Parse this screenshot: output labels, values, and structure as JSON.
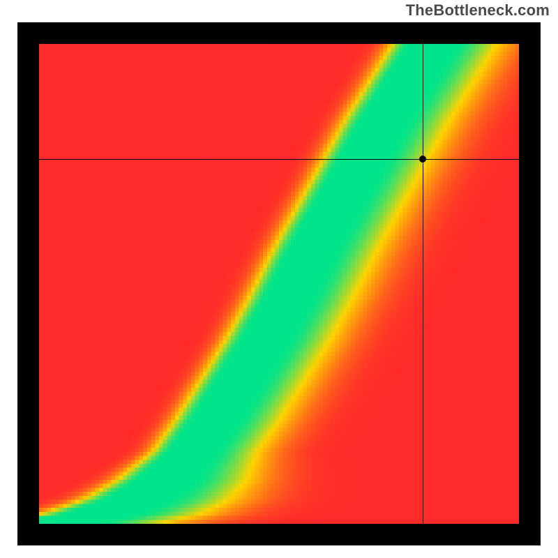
{
  "attribution": "TheBottleneck.com",
  "chart_data": {
    "type": "heatmap",
    "title": "",
    "xlabel": "",
    "ylabel": "",
    "xlim": [
      0,
      100
    ],
    "ylim": [
      0,
      100
    ],
    "color_scale": {
      "min_color": "#ff2a2a",
      "mid_color": "#ffd400",
      "max_color": "#00e58b",
      "description": "red (worst) → yellow → green (optimal)"
    },
    "optimal_ridge": [
      {
        "x": 0,
        "y": 0
      },
      {
        "x": 10,
        "y": 2
      },
      {
        "x": 18,
        "y": 5
      },
      {
        "x": 24,
        "y": 9
      },
      {
        "x": 30,
        "y": 15
      },
      {
        "x": 35,
        "y": 22
      },
      {
        "x": 40,
        "y": 30
      },
      {
        "x": 45,
        "y": 38
      },
      {
        "x": 50,
        "y": 47
      },
      {
        "x": 55,
        "y": 57
      },
      {
        "x": 60,
        "y": 66
      },
      {
        "x": 65,
        "y": 75
      },
      {
        "x": 70,
        "y": 84
      },
      {
        "x": 75,
        "y": 92
      },
      {
        "x": 80,
        "y": 100
      }
    ],
    "ridge_half_width": 6,
    "asymmetry": 0.55,
    "marker_point": {
      "x": 80,
      "y": 76
    },
    "crosshair": {
      "x": 80,
      "y": 76
    }
  }
}
